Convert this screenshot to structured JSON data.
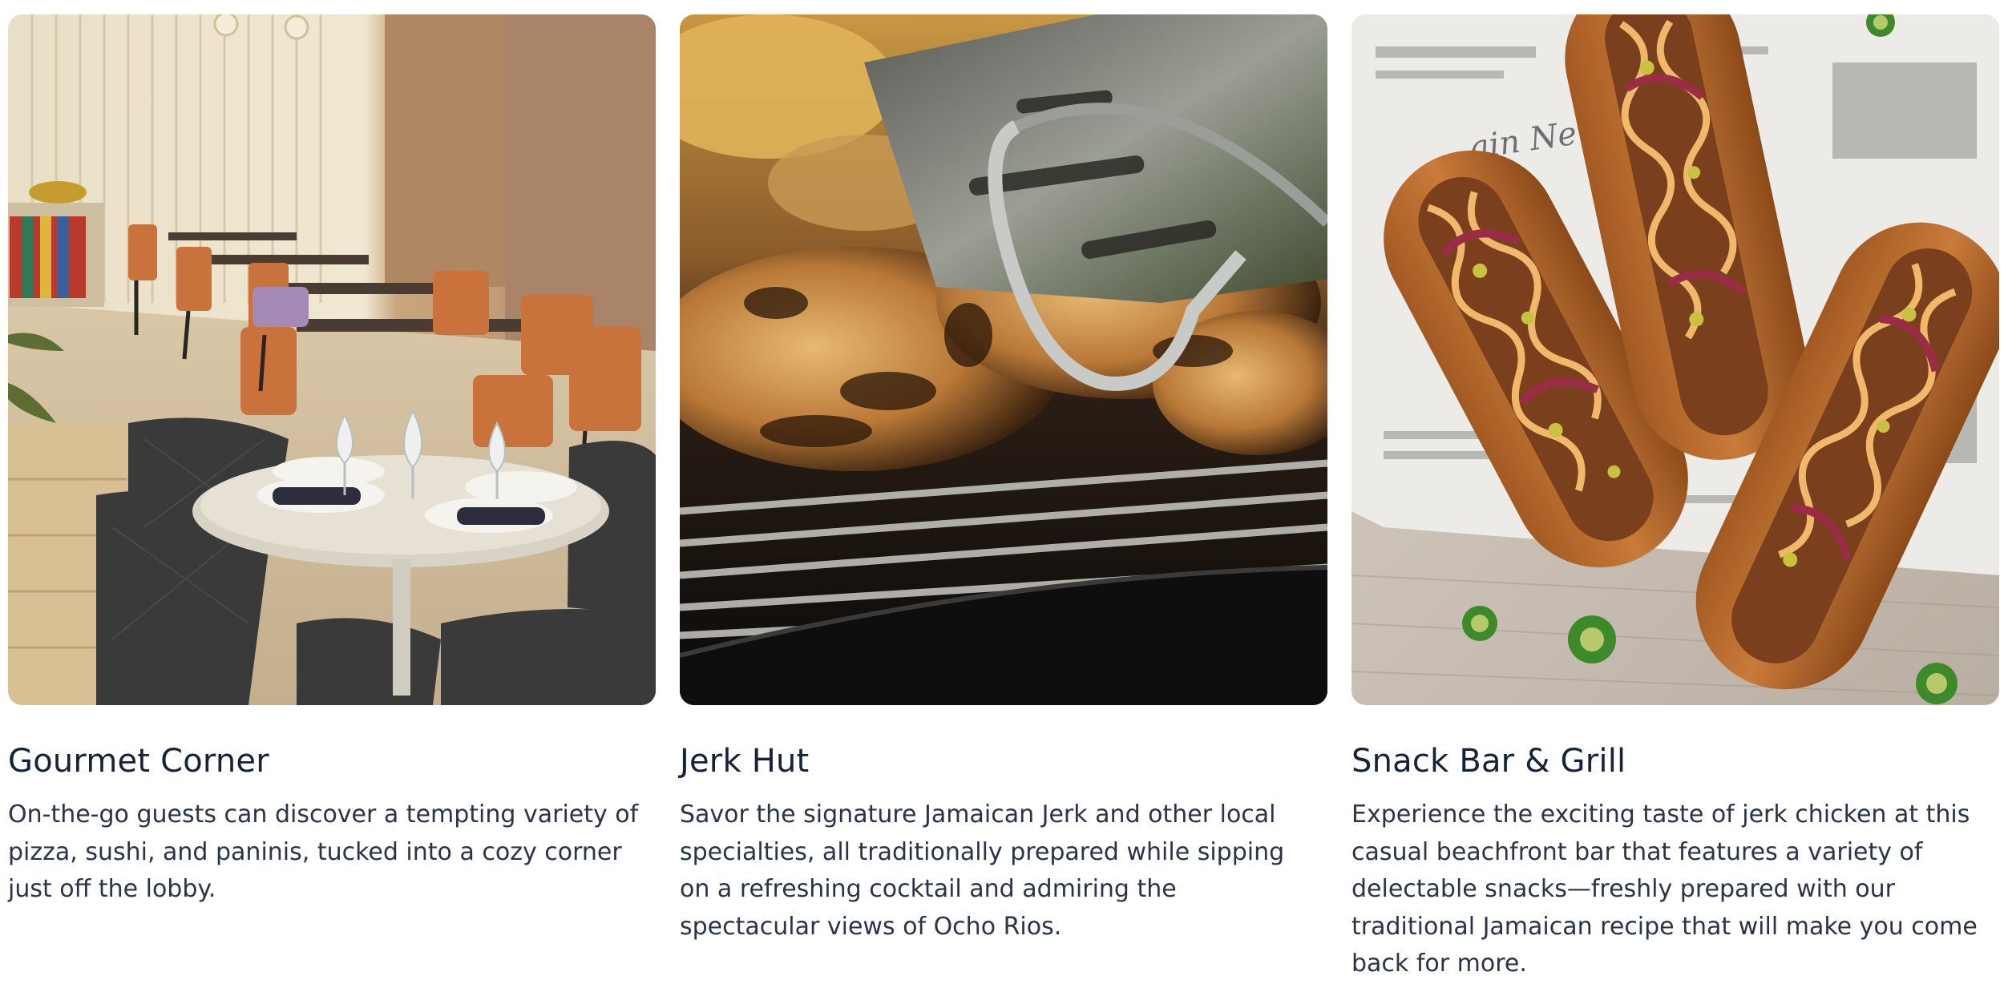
{
  "cards": [
    {
      "title": "Gourmet Corner",
      "description": "On-the-go guests can discover a tempting variety of pizza, sushi, and paninis, tucked into a cozy corner just off the lobby.",
      "image": "restaurant-dining-room-photo"
    },
    {
      "title": "Jerk Hut",
      "description": "Savor the signature Jamaican Jerk and other local specialties, all traditionally prepared while sipping on a refreshing cocktail and admiring the spectacular views of Ocho Rios.",
      "image": "grilled-jerk-chicken-photo"
    },
    {
      "title": "Snack Bar & Grill",
      "description": "Experience the exciting taste of jerk chicken at this casual beachfront bar that features a variety of delectable snacks—freshly prepared with our traditional Jamaican recipe that will make you come back for more.",
      "image": "hot-dogs-on-newspaper-photo"
    }
  ],
  "colors": {
    "heading": "#15223a",
    "body_text": "#2a3448",
    "background": "#ffffff"
  }
}
